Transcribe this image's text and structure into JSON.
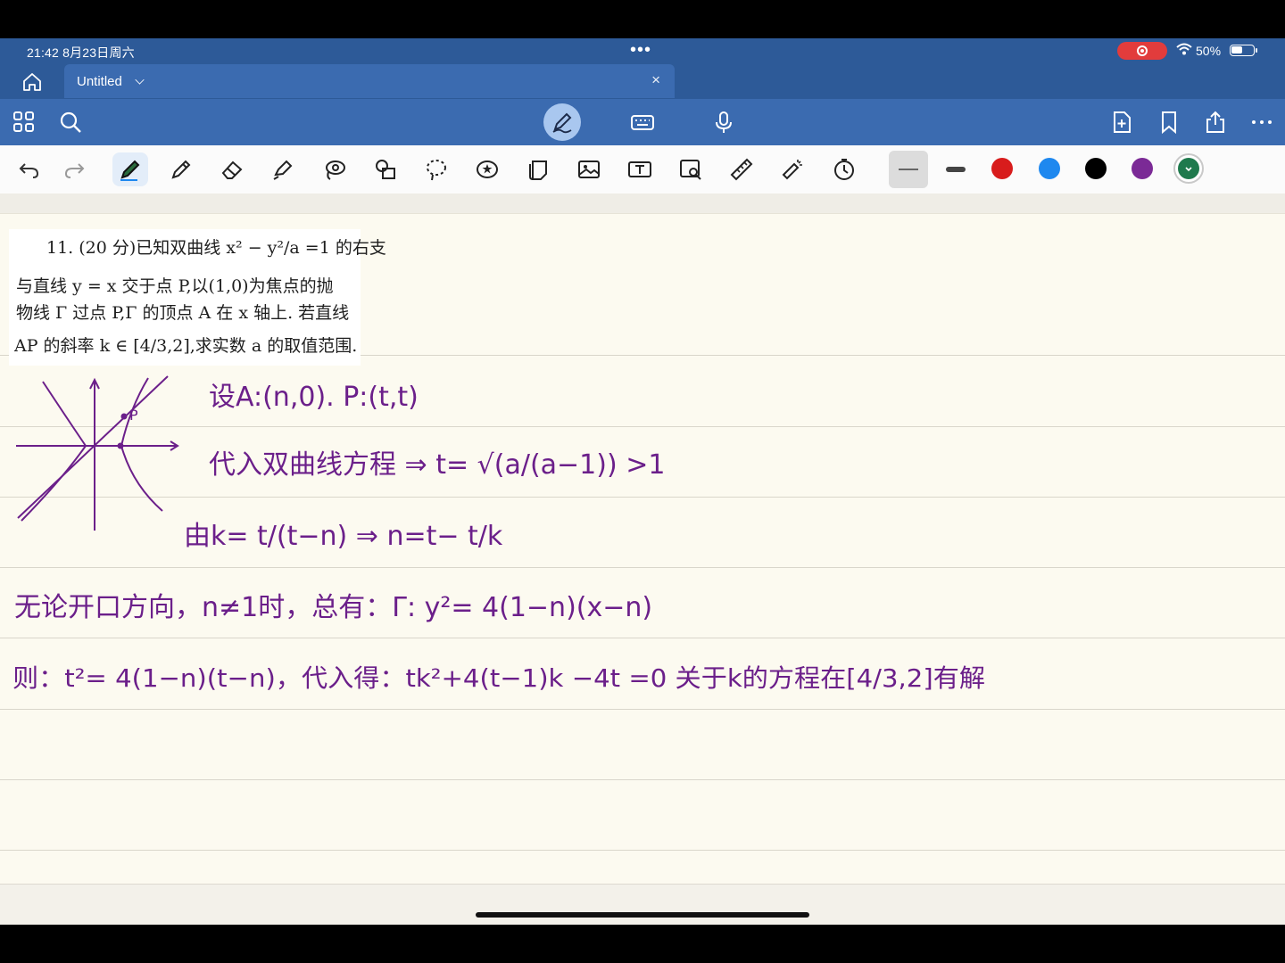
{
  "status": {
    "time": "21:42  8月23日周六",
    "multitask": "•••",
    "battery": "50%"
  },
  "tab": {
    "title": "Untitled",
    "close": "×"
  },
  "problem": {
    "line1": "11. (20 分)已知双曲线 x² − y²/a =1 的右支",
    "line2": "与直线 y = x 交于点 P,以(1,0)为焦点的抛",
    "line3": "物线 Γ 过点 P,Γ 的顶点 A 在 x 轴上. 若直线",
    "line4": "AP 的斜率 k ∈ [4/3,2],求实数 a 的取值范围."
  },
  "handwriting": {
    "graph_label": "P",
    "line1": "设A:(n,0). P:(t,t)",
    "line2": "代入双曲线方程 ⇒ t= √(a/(a−1)) >1",
    "line3": "由k= t/(t−n) ⇒ n=t− t/k",
    "line4": "无论开口方向，n≠1时，总有：Γ: y²= 4(1−n)(x−n)",
    "line5": "则：t²= 4(1−n)(t−n)，代入得：tk²+4(t−1)k −4t =0  关于k的方程在[4/3,2]有解"
  },
  "colors": {
    "chrome_blue": "#2d5a98",
    "ink": "#6b1f8a",
    "palette": [
      "#d81c1c",
      "#1e88ef",
      "#000000",
      "#7b2a96",
      "#1f7a4d"
    ]
  },
  "icons": [
    "home-icon",
    "grid-icon",
    "search-icon",
    "pen-mode-icon",
    "keyboard-icon",
    "mic-icon",
    "add-page-icon",
    "bookmark-icon",
    "share-icon",
    "more-icon",
    "undo-icon",
    "redo-icon",
    "pen-icon",
    "pencil-icon",
    "eraser-icon",
    "highlighter-icon",
    "lasso-icon",
    "shapes-icon",
    "selection-icon",
    "sticker-icon",
    "note-icon",
    "image-icon",
    "text-icon",
    "image-search-icon",
    "ruler-icon",
    "laser-icon",
    "timer-icon"
  ]
}
